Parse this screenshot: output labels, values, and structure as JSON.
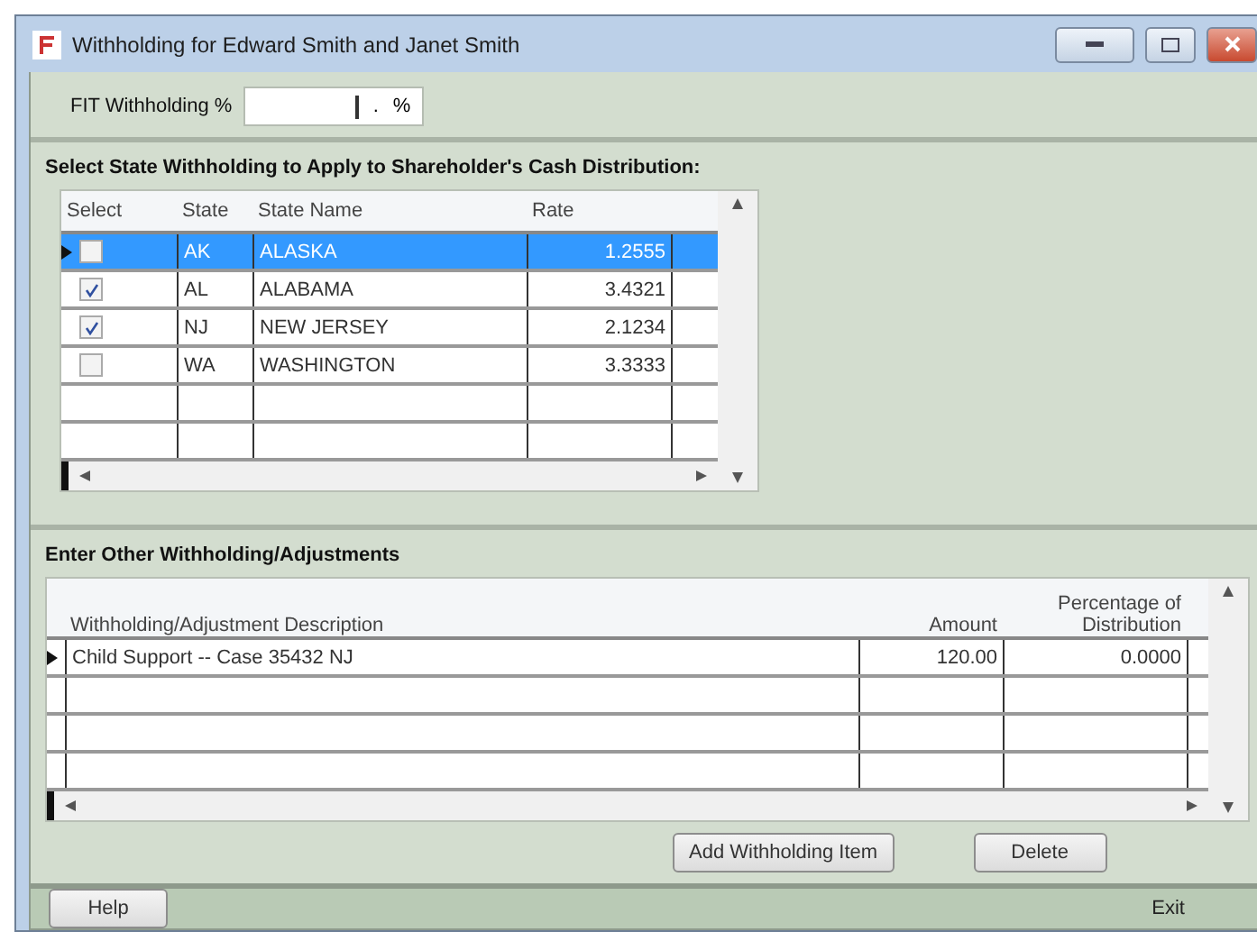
{
  "window": {
    "title": "Withholding for Edward Smith and Janet Smith"
  },
  "fit": {
    "label": "FIT Withholding %",
    "value": ".",
    "unit": "%"
  },
  "state_section": {
    "heading": "Select State Withholding to Apply to Shareholder's Cash Distribution:",
    "columns": [
      "Select",
      "State",
      "State Name",
      "Rate"
    ],
    "rows": [
      {
        "checked": false,
        "state": "AK",
        "name": "ALASKA",
        "rate": "1.2555",
        "selected": true
      },
      {
        "checked": true,
        "state": "AL",
        "name": "ALABAMA",
        "rate": "3.4321",
        "selected": false
      },
      {
        "checked": true,
        "state": "NJ",
        "name": "NEW JERSEY",
        "rate": "2.1234",
        "selected": false
      },
      {
        "checked": false,
        "state": "WA",
        "name": "WASHINGTON",
        "rate": "3.3333",
        "selected": false
      }
    ]
  },
  "other_section": {
    "heading": "Enter Other Withholding/Adjustments",
    "columns": [
      "Withholding/Adjustment Description",
      "Amount",
      "Percentage of Distribution"
    ],
    "rows": [
      {
        "description": "Child Support  -- Case 35432 NJ",
        "amount": "120.00",
        "percentage": "0.0000",
        "current": true
      }
    ],
    "buttons": [
      "Add Withholding Item",
      "Delete"
    ]
  },
  "footer": {
    "help": "Help",
    "exit": "Exit"
  }
}
